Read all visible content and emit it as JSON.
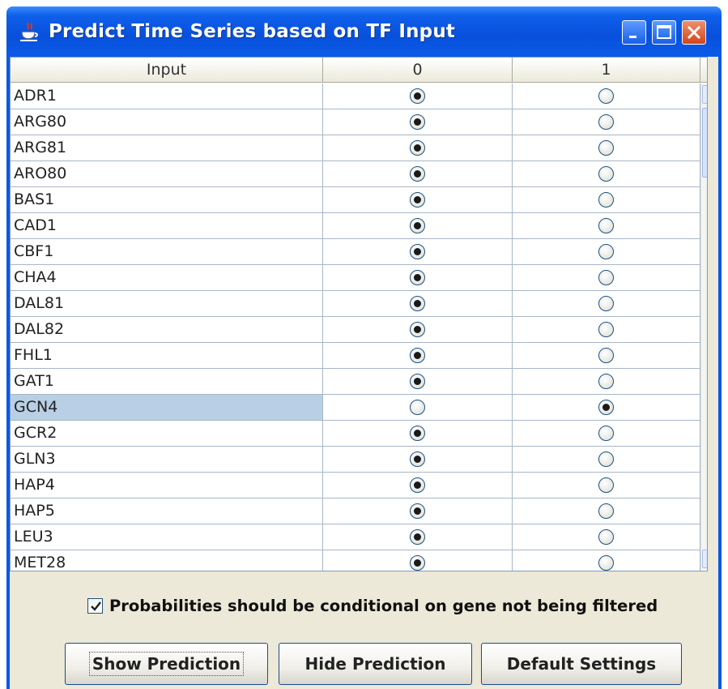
{
  "window": {
    "title": "Predict Time Series based on TF Input",
    "colors": {
      "titlebar": "#0a58e4",
      "selected_row": "#b8cfe5",
      "close_button": "#d4431c"
    }
  },
  "table": {
    "columns": [
      "Input",
      "0",
      "1"
    ],
    "rows": [
      {
        "name": "ADR1",
        "selected": 0
      },
      {
        "name": "ARG80",
        "selected": 0
      },
      {
        "name": "ARG81",
        "selected": 0
      },
      {
        "name": "ARO80",
        "selected": 0
      },
      {
        "name": "BAS1",
        "selected": 0
      },
      {
        "name": "CAD1",
        "selected": 0
      },
      {
        "name": "CBF1",
        "selected": 0
      },
      {
        "name": "CHA4",
        "selected": 0
      },
      {
        "name": "DAL81",
        "selected": 0
      },
      {
        "name": "DAL82",
        "selected": 0
      },
      {
        "name": "FHL1",
        "selected": 0
      },
      {
        "name": "GAT1",
        "selected": 0
      },
      {
        "name": "GCN4",
        "selected": 1,
        "highlighted": true
      },
      {
        "name": "GCR2",
        "selected": 0
      },
      {
        "name": "GLN3",
        "selected": 0
      },
      {
        "name": "HAP4",
        "selected": 0
      },
      {
        "name": "HAP5",
        "selected": 0
      },
      {
        "name": "LEU3",
        "selected": 0
      },
      {
        "name": "MET28",
        "selected": 0
      }
    ]
  },
  "options": {
    "conditional_label": "Probabilities should be conditional on gene not being filtered",
    "conditional_checked": true
  },
  "buttons": {
    "show": "Show Prediction",
    "hide": "Hide Prediction",
    "defaults": "Default Settings"
  }
}
